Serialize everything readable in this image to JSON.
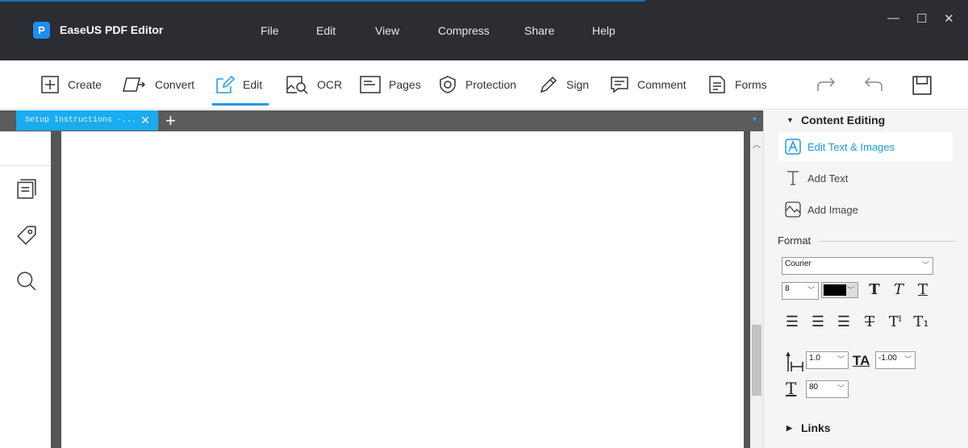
{
  "app": {
    "title": "EaseUS PDF Editor",
    "logo_letter": "P"
  },
  "menu": [
    "File",
    "Edit",
    "View",
    "Compress",
    "Share",
    "Help"
  ],
  "window_controls": {
    "minimize": "—",
    "maximize": "☐",
    "close": "✕"
  },
  "toolbar": {
    "items": [
      {
        "label": "Create",
        "icon": "plus-box-icon"
      },
      {
        "label": "Convert",
        "icon": "convert-icon"
      },
      {
        "label": "Edit",
        "icon": "edit-pencil-icon"
      },
      {
        "label": "OCR",
        "icon": "ocr-icon"
      },
      {
        "label": "Pages",
        "icon": "pages-icon"
      },
      {
        "label": "Protection",
        "icon": "shield-icon"
      },
      {
        "label": "Sign",
        "icon": "pen-icon"
      },
      {
        "label": "Comment",
        "icon": "comment-icon"
      },
      {
        "label": "Forms",
        "icon": "forms-icon"
      }
    ],
    "active": "Edit"
  },
  "tabs": [
    {
      "label": "Setup Instructions -...",
      "close": "✕"
    }
  ],
  "add_tab": "+",
  "right_panel": {
    "content_editing": {
      "title": "Content Editing",
      "items": [
        "Edit Text & Images",
        "Add Text",
        "Add Image"
      ],
      "selected": "Edit Text & Images"
    },
    "format": {
      "title": "Format",
      "font": "Courier",
      "size": "8",
      "color": "#000000",
      "line_spacing": "1.0",
      "char_spacing": "-1.00",
      "scale": "80"
    },
    "links": {
      "title": "Links"
    }
  },
  "colors": {
    "accent": "#1a9be6",
    "titlebar": "#2b2d33",
    "tab": "#1aabf0"
  }
}
